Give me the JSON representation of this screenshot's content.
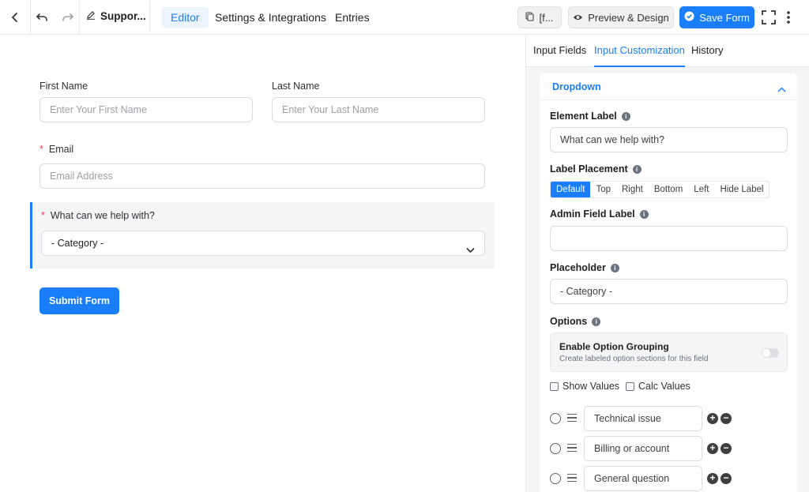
{
  "topbar": {
    "back_icon": "chevron-left-icon",
    "undo_icon": "undo-icon",
    "redo_icon": "redo-icon",
    "form_title": "Suppor...",
    "tabs": [
      {
        "label": "Editor",
        "active": true
      },
      {
        "label": "Settings & Integrations",
        "active": false
      },
      {
        "label": "Entries",
        "active": false
      }
    ],
    "shortcode_label": "[f...",
    "preview_label": "Preview & Design",
    "save_label": "Save Form",
    "accent_color": "#1a7efb"
  },
  "form": {
    "first_name": {
      "label": "First Name",
      "placeholder": "Enter Your First Name"
    },
    "last_name": {
      "label": "Last Name",
      "placeholder": "Enter Your Last Name"
    },
    "email": {
      "required_mark": "*",
      "label": "Email",
      "placeholder": "Email Address"
    },
    "dropdown": {
      "required_mark": "*",
      "label": "What can we help with?",
      "value": "- Category -"
    },
    "submit_label": "Submit Form"
  },
  "panel": {
    "tabs": [
      {
        "label": "Input Fields",
        "active": false
      },
      {
        "label": "Input Customization",
        "active": true
      },
      {
        "label": "History",
        "active": false
      }
    ],
    "section_title": "Dropdown",
    "element_label": {
      "label": "Element Label",
      "value": "What can we help with?"
    },
    "label_placement": {
      "label": "Label Placement",
      "options": [
        "Default",
        "Top",
        "Right",
        "Bottom",
        "Left",
        "Hide Label"
      ],
      "selected": "Default"
    },
    "admin_field_label": {
      "label": "Admin Field Label",
      "value": ""
    },
    "placeholder": {
      "label": "Placeholder",
      "value": "- Category -"
    },
    "options": {
      "label": "Options",
      "grouping_title": "Enable Option Grouping",
      "grouping_desc": "Create labeled option sections for this field",
      "grouping_enabled": false,
      "show_values_label": "Show Values",
      "calc_values_label": "Calc Values",
      "items": [
        "Technical issue",
        "Billing or account",
        "General question"
      ]
    }
  }
}
